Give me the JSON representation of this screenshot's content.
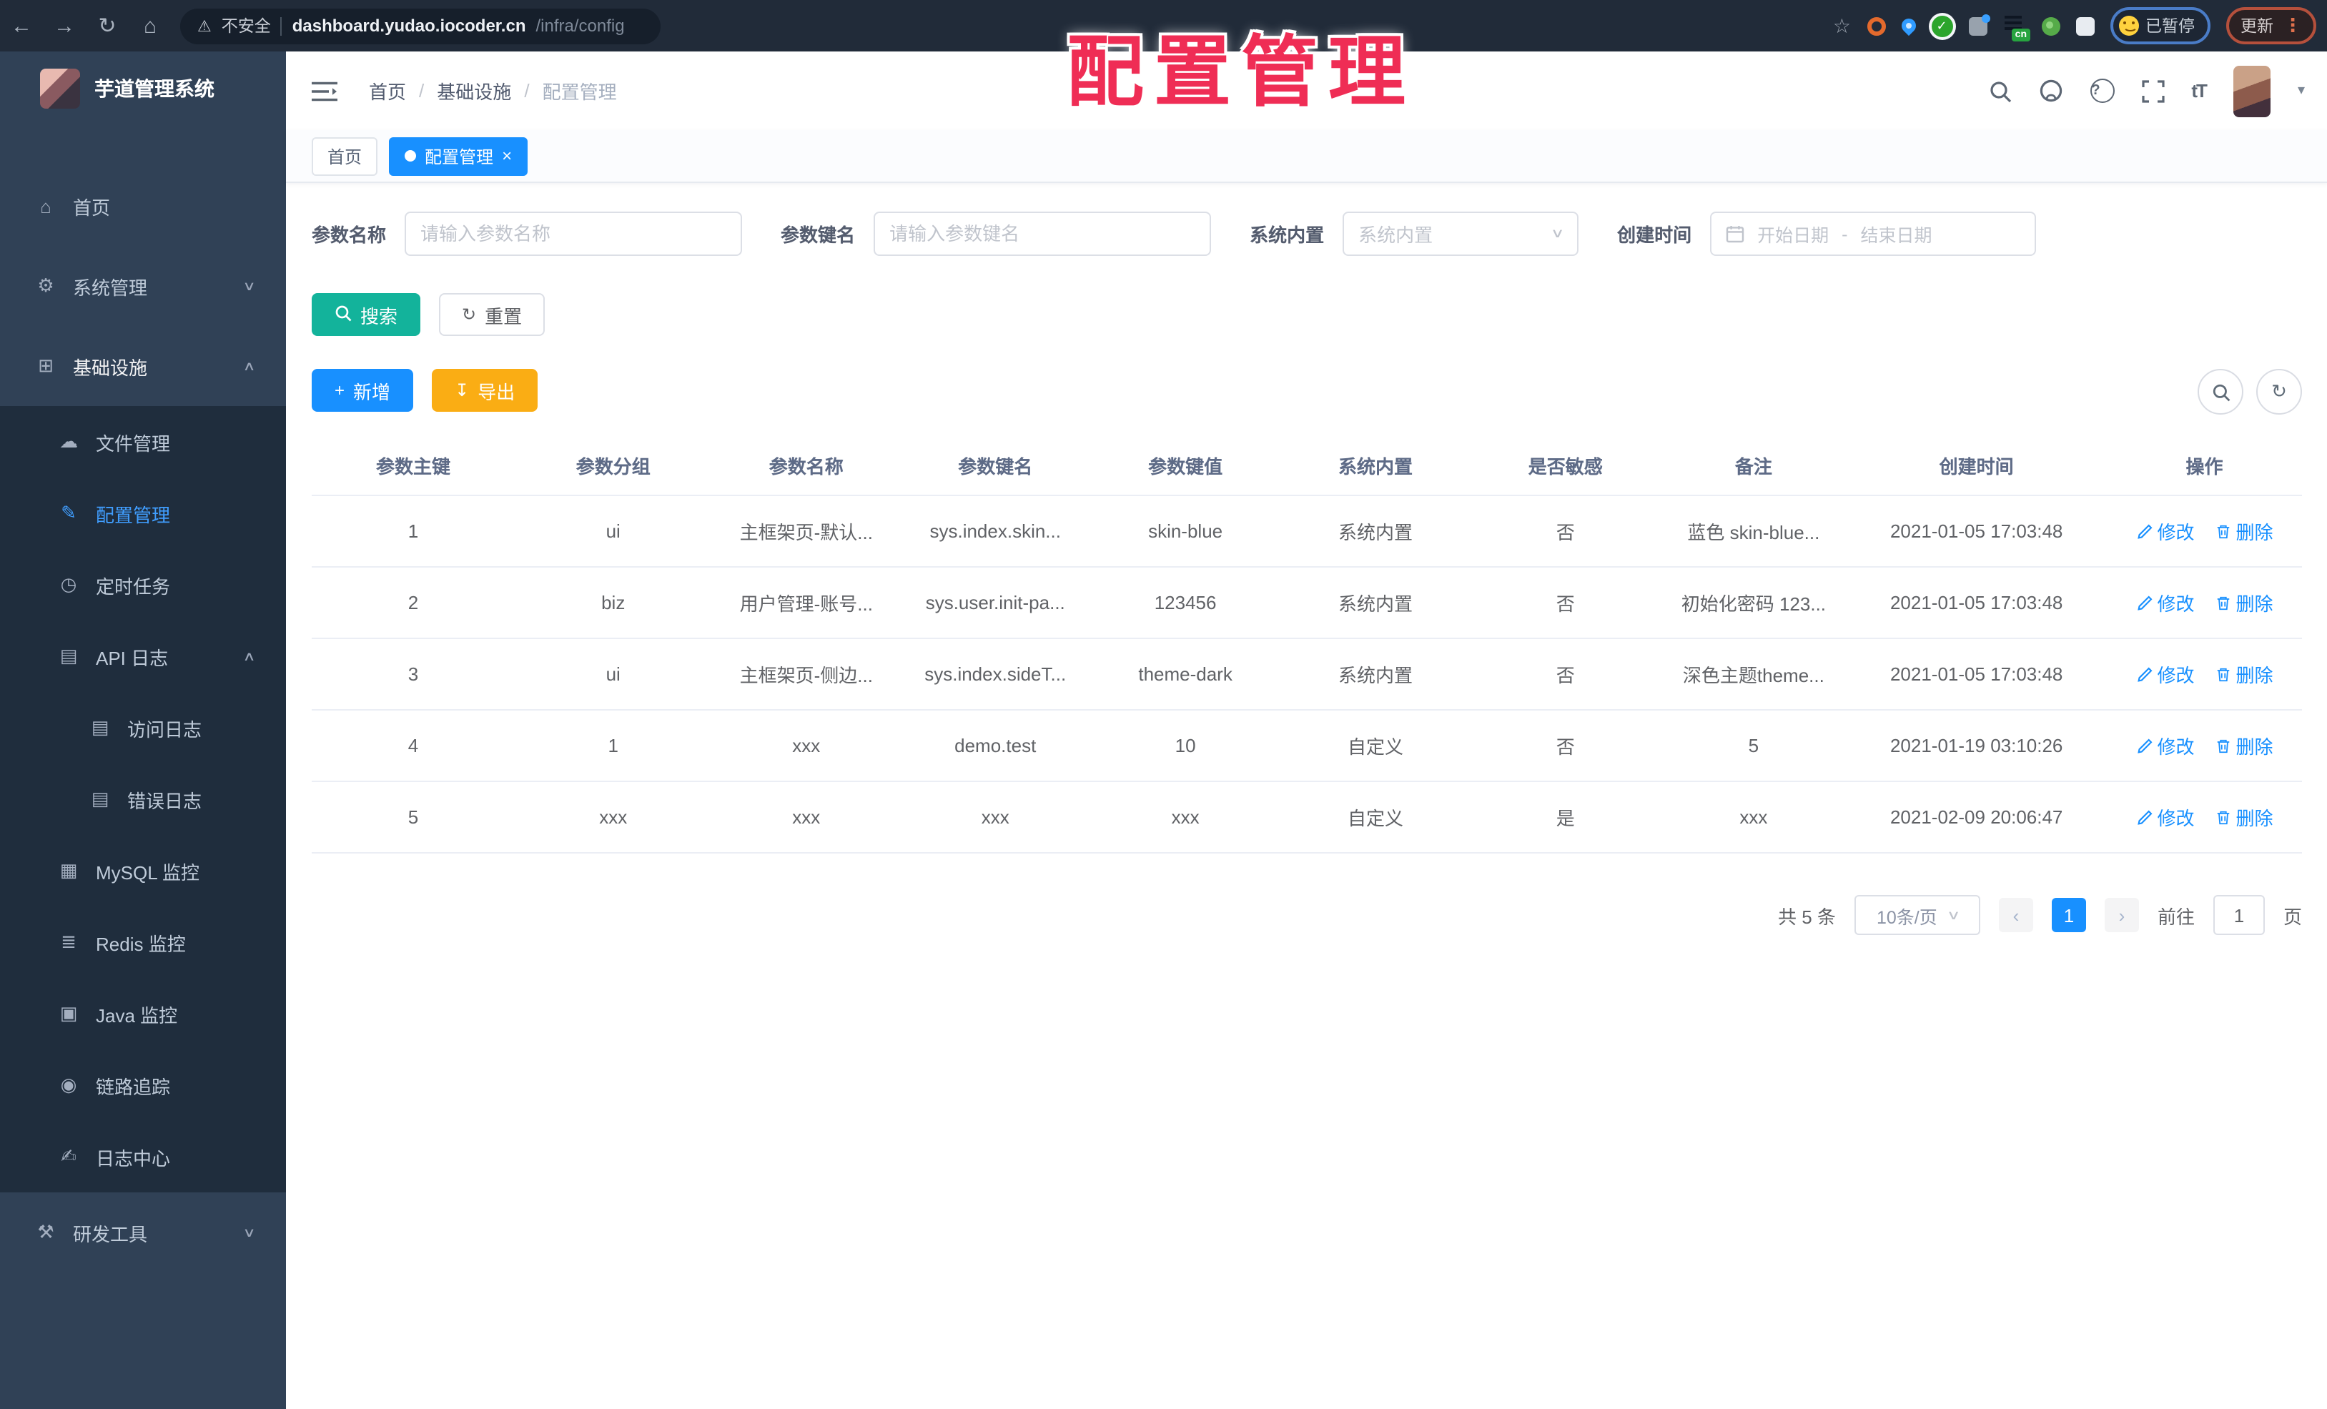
{
  "browser": {
    "security_label": "不安全",
    "url_host": "dashboard.yudao.iocoder.cn",
    "url_path": "/infra/config",
    "extension_cn_badge": "cn",
    "paused_badge_label": "已暂停",
    "update_button_label": "更新"
  },
  "icons": {
    "back": "←",
    "forward": "→",
    "reload": "↻",
    "home": "⌂",
    "warning": "⚠",
    "star": "☆",
    "kebab": "⋮",
    "check": "✓",
    "close": "×",
    "caret_down": "▾",
    "select_caret": "∨",
    "chevron_down": "∨",
    "chevron_up": "∧",
    "prev": "‹",
    "next": "›",
    "font_size": "tT",
    "reset": "↻",
    "plus": "+",
    "download": "↧",
    "refresh": "↻"
  },
  "watermark_text": "配置管理",
  "sidebar": {
    "title": "芋道管理系统",
    "items": [
      {
        "label": "首页",
        "icon": "⌂"
      },
      {
        "label": "系统管理",
        "icon": "⚙",
        "chevron": "∨"
      },
      {
        "label": "基础设施",
        "icon": "⊞",
        "chevron": "∧"
      },
      {
        "label": "文件管理",
        "icon": "☁"
      },
      {
        "label": "配置管理",
        "icon": "✎"
      },
      {
        "label": "定时任务",
        "icon": "◷"
      },
      {
        "label": "API 日志",
        "icon": "▤",
        "chevron": "∧"
      },
      {
        "label": "访问日志",
        "icon": "▤"
      },
      {
        "label": "错误日志",
        "icon": "▤"
      },
      {
        "label": "MySQL 监控",
        "icon": "▦"
      },
      {
        "label": "Redis 监控",
        "icon": "≣"
      },
      {
        "label": "Java 监控",
        "icon": "▣"
      },
      {
        "label": "链路追踪",
        "icon": "◉"
      },
      {
        "label": "日志中心",
        "icon": "✍"
      },
      {
        "label": "研发工具",
        "icon": "⚒",
        "chevron": "∨"
      }
    ]
  },
  "breadcrumb": {
    "separator": "/",
    "items": [
      "首页",
      "基础设施",
      "配置管理"
    ]
  },
  "tabs": {
    "home": "首页",
    "active": "配置管理"
  },
  "filters": {
    "name_label": "参数名称",
    "name_placeholder": "请输入参数名称",
    "key_label": "参数键名",
    "key_placeholder": "请输入参数键名",
    "type_label": "系统内置",
    "type_placeholder": "系统内置",
    "time_label": "创建时间",
    "time_start": "开始日期",
    "time_separator": "-",
    "time_end": "结束日期"
  },
  "buttons": {
    "search": "搜索",
    "reset": "重置",
    "add": "新增",
    "export": "导出"
  },
  "table": {
    "columns": [
      "参数主键",
      "参数分组",
      "参数名称",
      "参数键名",
      "参数键值",
      "系统内置",
      "是否敏感",
      "备注",
      "创建时间",
      "操作"
    ],
    "edit": "修改",
    "delete": "删除",
    "rows": [
      [
        "1",
        "ui",
        "主框架页-默认...",
        "sys.index.skin...",
        "skin-blue",
        "系统内置",
        "否",
        "蓝色 skin-blue...",
        "2021-01-05 17:03:48"
      ],
      [
        "2",
        "biz",
        "用户管理-账号...",
        "sys.user.init-pa...",
        "123456",
        "系统内置",
        "否",
        "初始化密码 123...",
        "2021-01-05 17:03:48"
      ],
      [
        "3",
        "ui",
        "主框架页-侧边...",
        "sys.index.sideT...",
        "theme-dark",
        "系统内置",
        "否",
        "深色主题theme...",
        "2021-01-05 17:03:48"
      ],
      [
        "4",
        "1",
        "xxx",
        "demo.test",
        "10",
        "自定义",
        "否",
        "5",
        "2021-01-19 03:10:26"
      ],
      [
        "5",
        "xxx",
        "xxx",
        "xxx",
        "xxx",
        "自定义",
        "是",
        "xxx",
        "2021-02-09 20:06:47"
      ]
    ]
  },
  "pagination": {
    "total": "共 5 条",
    "page_size": "10条/页",
    "current_page": "1",
    "goto_label": "前往",
    "goto_value": "1",
    "page_unit": "页"
  },
  "colors": {
    "accent_blue": "#1890ff",
    "menu_active_blue": "#409eff",
    "search_teal": "#13b39b",
    "export_orange": "#faad14",
    "watermark_red": "#ef2d55"
  }
}
